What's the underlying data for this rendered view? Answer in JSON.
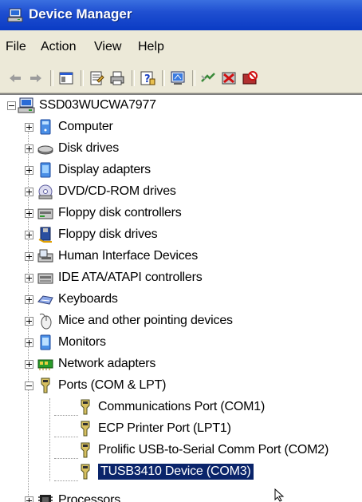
{
  "window": {
    "title": "Device Manager"
  },
  "menu": [
    {
      "label": "File"
    },
    {
      "label": "Action"
    },
    {
      "label": "View"
    },
    {
      "label": "Help"
    }
  ],
  "toolbar": [
    "back-arrow-icon",
    "forward-arrow-icon",
    "console-tree-icon",
    "properties-icon",
    "print-icon",
    "help-icon",
    "scan-hardware-icon",
    "update-driver-icon",
    "uninstall-icon",
    "disable-icon"
  ],
  "tree": {
    "root": "SSD03WUCWA7977",
    "categories": [
      {
        "label": "Computer",
        "icon": "computer-icon"
      },
      {
        "label": "Disk drives",
        "icon": "disk-drive-icon"
      },
      {
        "label": "Display adapters",
        "icon": "display-adapter-icon"
      },
      {
        "label": "DVD/CD-ROM drives",
        "icon": "dvd-drive-icon"
      },
      {
        "label": "Floppy disk controllers",
        "icon": "floppy-controller-icon"
      },
      {
        "label": "Floppy disk drives",
        "icon": "floppy-drive-icon"
      },
      {
        "label": "Human Interface Devices",
        "icon": "hid-icon"
      },
      {
        "label": "IDE ATA/ATAPI controllers",
        "icon": "ide-controller-icon"
      },
      {
        "label": "Keyboards",
        "icon": "keyboard-icon"
      },
      {
        "label": "Mice and other pointing devices",
        "icon": "mouse-icon"
      },
      {
        "label": "Monitors",
        "icon": "monitor-icon"
      },
      {
        "label": "Network adapters",
        "icon": "network-adapter-icon"
      },
      {
        "label": "Ports (COM & LPT)",
        "icon": "port-icon"
      }
    ],
    "ports": [
      {
        "label": "Communications Port (COM1)"
      },
      {
        "label": "ECP Printer Port (LPT1)"
      },
      {
        "label": "Prolific USB-to-Serial Comm Port (COM2)"
      },
      {
        "label": "TUSB3410 Device (COM3)",
        "selected": true
      }
    ],
    "after": {
      "label": "Processors",
      "icon": "processor-icon"
    }
  },
  "colors": {
    "titlebar": "#0a3bc4",
    "selection": "#0a246a",
    "chrome": "#ece9d8"
  }
}
